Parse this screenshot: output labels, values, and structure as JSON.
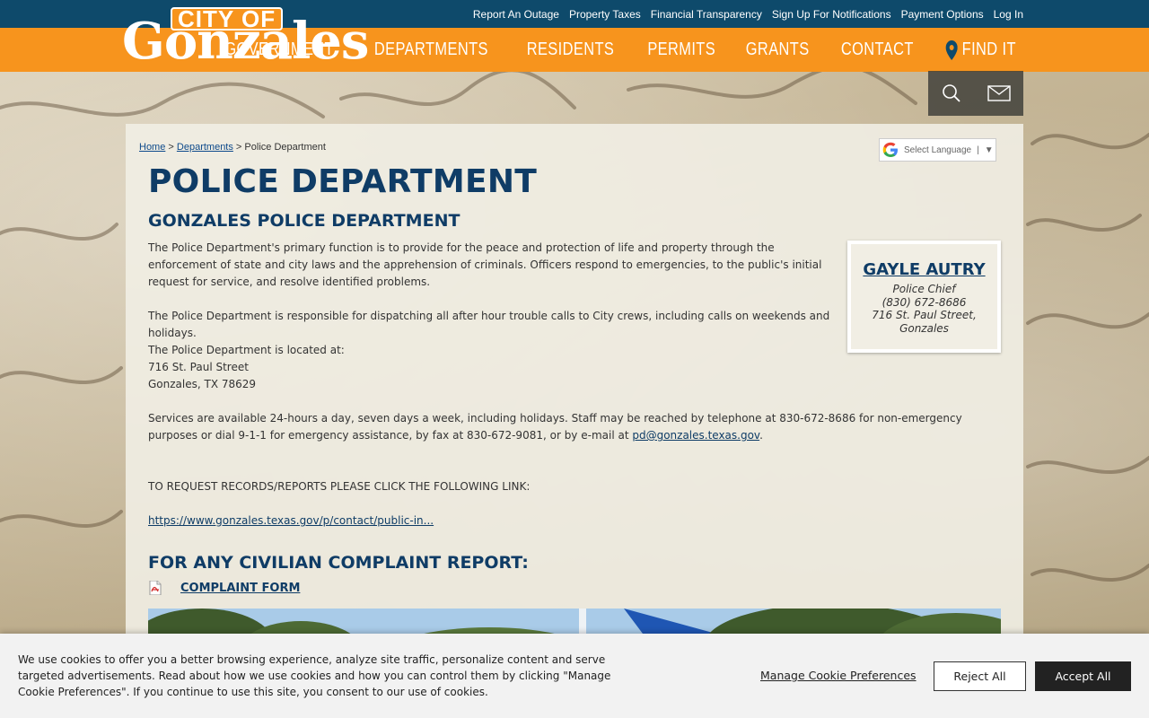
{
  "utility_links": [
    "Report An Outage",
    "Property Taxes",
    "Financial Transparency",
    "Sign Up For Notifications",
    "Payment Options",
    "Log In"
  ],
  "logo": {
    "top": "CITY OF",
    "main": "Gonzales"
  },
  "main_nav": [
    "GOVERNMENT",
    "DEPARTMENTS",
    "RESIDENTS",
    "PERMITS",
    "GRANTS",
    "CONTACT"
  ],
  "find_it": "FIND IT",
  "breadcrumb": {
    "home": "Home",
    "sep1": " > ",
    "departments": "Departments",
    "sep2": " > ",
    "current": "Police Department"
  },
  "translate": {
    "label": "Select Language",
    "separator": "|",
    "arrow": "▼"
  },
  "page_title": "POLICE DEPARTMENT",
  "sub_title": "GONZALES POLICE DEPARTMENT",
  "paragraphs": {
    "p1": "The Police Department's primary function is to provide for the peace and protection of life and property through the enforcement of state and city laws and the apprehension of criminals. Officers respond to emergencies, to the public's initial request for service, and resolve identified problems.",
    "p2": "The Police Department is responsible for dispatching all after hour trouble calls to City crews, including calls on weekends and holidays.",
    "p3_line1": "The Police Department is located at:",
    "p3_line2": "716 St. Paul Street",
    "p3_line3": "Gonzales, TX 78629",
    "p4_text": "Services are available 24-hours a day, seven days a week, including holidays. Staff may be reached by telephone at 830-672-8686 for non-emergency purposes or dial 9-1-1 for emergency assistance, by fax at 830-672-9081, or by e-mail at ",
    "p4_email": "pd@gonzales.texas.gov",
    "p4_end": ".",
    "records_label": "TO REQUEST RECORDS/REPORTS PLEASE CLICK THE FOLLOWING LINK:",
    "records_link": "https://www.gonzales.texas.gov/p/contact/public-in..."
  },
  "chief": {
    "name": "GAYLE AUTRY",
    "title": "Police Chief",
    "phone": "(830) 672-8686",
    "address1": "716 St. Paul Street,",
    "address2": "Gonzales"
  },
  "complaint": {
    "heading": "FOR ANY CIVILIAN COMPLAINT REPORT:",
    "link": "COMPLAINT FORM"
  },
  "cookie": {
    "text": "We use cookies to offer you a better browsing experience, analyze site traffic, personalize content and serve targeted advertisements. Read about how we use cookies and how you can control them by clicking \"Manage Cookie Preferences\". If you continue to use this site, you consent to our use of cookies.",
    "manage": "Manage Cookie Preferences",
    "reject": "Reject All",
    "accept": "Accept All"
  },
  "colors": {
    "utility_bar": "#0e4a6b",
    "nav_bar": "#f7941d",
    "title": "#0f3c66"
  }
}
